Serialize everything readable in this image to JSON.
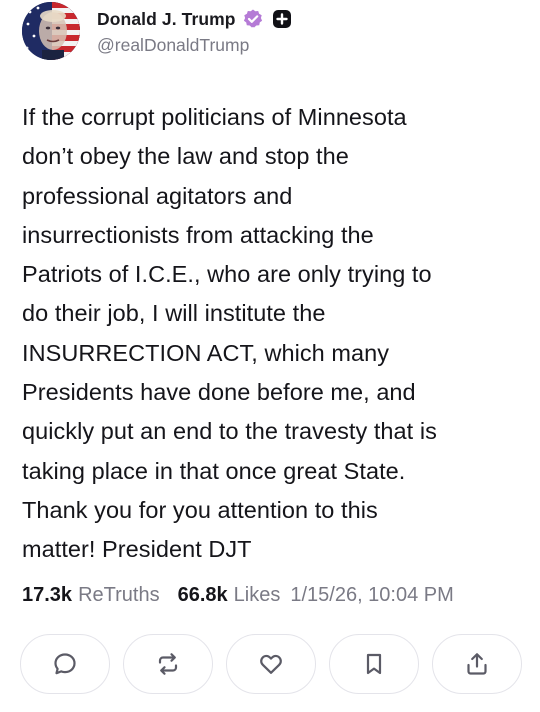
{
  "post": {
    "author": {
      "display_name": "Donald J. Trump",
      "handle": "@realDonaldTrump",
      "verified": true
    },
    "text": "If the corrupt politicians of Minnesota\ndon’t obey the law and stop the\nprofessional agitators and\ninsurrectionists from attacking the\nPatriots of I.C.E., who are only trying to\ndo their job, I will institute the\nINSURRECTION ACT, which many\nPresidents have done before me, and\nquickly put an end to the travesty that is\ntaking place in that once great State.\nThank you for you attention to this\nmatter! President DJT",
    "stats": {
      "retruths_count": "17.3k",
      "retruths_label": "ReTruths",
      "likes_count": "66.8k",
      "likes_label": "Likes",
      "timestamp": "1/15/26, 10:04 PM"
    }
  },
  "actions": [
    {
      "icon": "comment-icon"
    },
    {
      "icon": "retruth-icon"
    },
    {
      "icon": "heart-icon"
    },
    {
      "icon": "bookmark-icon"
    },
    {
      "icon": "share-icon"
    }
  ],
  "colors": {
    "verified_badge": "#b57bd6",
    "muted_text": "#7a7a85",
    "button_border": "#e4e4ea",
    "icon_stroke": "#5b5b66"
  }
}
